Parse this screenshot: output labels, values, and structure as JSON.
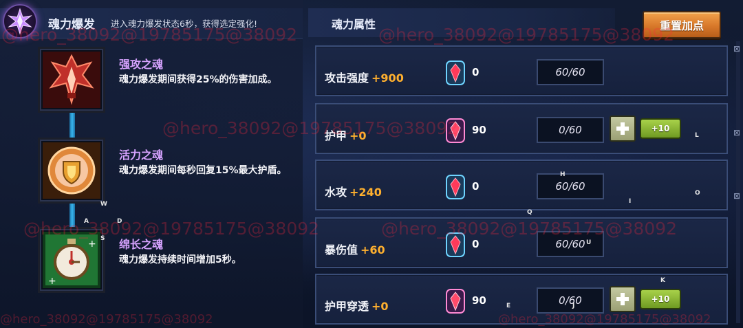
{
  "burst": {
    "title": "魂力爆发",
    "description": "进入魂力爆发状态6秒，获得选定强化!"
  },
  "souls": [
    {
      "name": "强攻之魂",
      "description": "魂力爆发期间获得25%的伤害加成。",
      "color": "#c0302a"
    },
    {
      "name": "活力之魂",
      "description": "魂力爆发期间每秒回复15%最大护盾。",
      "color": "#e0883a"
    },
    {
      "name": "绵长之魂",
      "description": "魂力爆发持续时间增加5秒。",
      "color": "#2fa84a"
    }
  ],
  "attributes": {
    "title": "魂力属性",
    "reset_label": "重置加点",
    "plus_label": "+",
    "plus10_label": "+10",
    "rows": [
      {
        "name": "攻击强度",
        "bonus": "+900",
        "gems": "0",
        "progress": "60/60",
        "show_buttons": false
      },
      {
        "name": "护甲",
        "bonus": "+0",
        "gems": "90",
        "progress": "0/60",
        "show_buttons": true
      },
      {
        "name": "水攻",
        "bonus": "+240",
        "gems": "0",
        "progress": "60/60",
        "show_buttons": false
      },
      {
        "name": "暴伤值",
        "bonus": "+60",
        "gems": "0",
        "progress": "60/60",
        "show_buttons": false
      },
      {
        "name": "护甲穿透",
        "bonus": "+0",
        "gems": "90",
        "progress": "0/60",
        "show_buttons": true
      }
    ]
  },
  "key_hints": [
    "W",
    "A",
    "D",
    "S",
    "L",
    "H",
    "I",
    "O",
    "Q",
    "U",
    "K",
    "E",
    "J"
  ],
  "watermarks": [
    "@hero_38092@19785175@38092",
    "@hero_38092@19785175@38092",
    "@hero_38092@19785175@38092",
    "@hero_38092@19785175@38092",
    "@hero_38092@19785175@38092",
    "@hero_38092@19785175@38092",
    "@hero_38092@19785175@38092"
  ],
  "colors": {
    "accent_orange": "#ffb02e",
    "soul_name": "#d7a3ff",
    "panel_border": "#3a4d78"
  }
}
